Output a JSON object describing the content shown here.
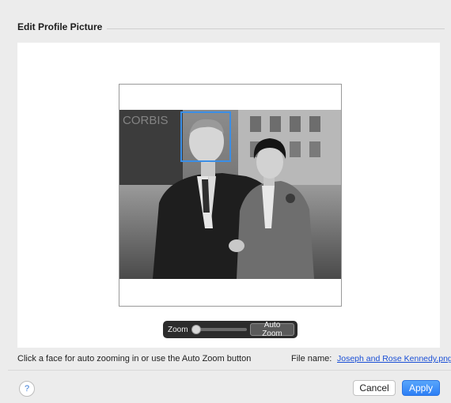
{
  "dialog": {
    "title": "Edit Profile Picture"
  },
  "photo": {
    "watermark": "CORBIS"
  },
  "zoom": {
    "label": "Zoom",
    "auto_zoom_label": "Auto Zoom",
    "level": 0
  },
  "footer": {
    "hint": "Click a face for auto zooming in or use the Auto Zoom button",
    "file_label": "File name:",
    "file_name": "Joseph and Rose Kennedy.png",
    "help_label": "?",
    "cancel_label": "Cancel",
    "apply_label": "Apply"
  },
  "colors": {
    "accent": "#3a8ee6",
    "apply_button": "#2d7ff5",
    "link": "#1a4fd6"
  }
}
